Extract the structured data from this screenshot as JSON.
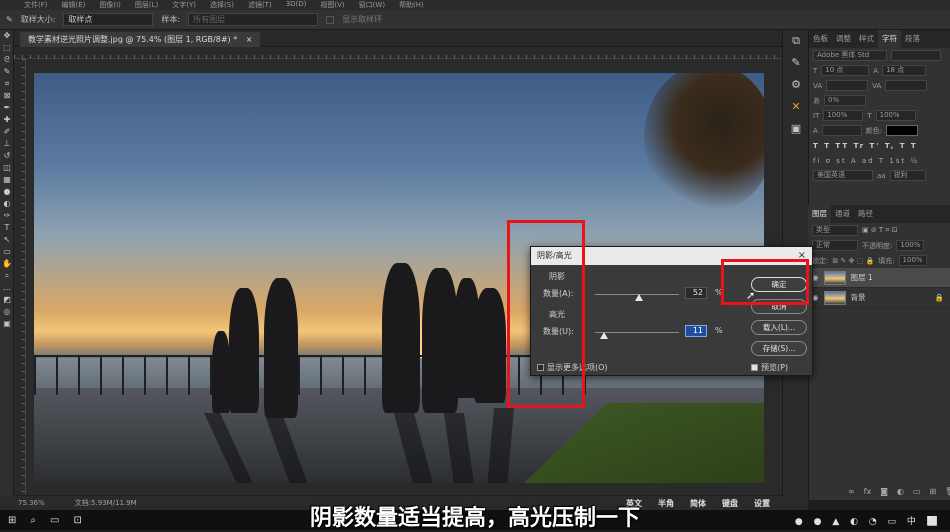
{
  "menubar": [
    "文件(F)",
    "编辑(E)",
    "图像(I)",
    "图层(L)",
    "文字(Y)",
    "选择(S)",
    "滤镜(T)",
    "3D(D)",
    "视图(V)",
    "窗口(W)",
    "帮助(H)"
  ],
  "optbar": {
    "sample_size_label": "取样大小:",
    "sample_size_value": "取样点",
    "sample_label": "样本:",
    "sample_value": "所有图层",
    "show_ring_label": "显示取样环"
  },
  "document": {
    "tab_title": "教学素材逆光照片调整.jpg @ 75.4% (图层 1, RGB/8#) *",
    "zoom": "75.36%",
    "doc_size": "文档:5.93M/11.9M"
  },
  "panels": {
    "tabs": [
      "色板",
      "调整",
      "样式",
      "字符",
      "段落"
    ],
    "active_tab": "字符",
    "font_family": "Adobe 黑体 Std",
    "font_size": "10 点",
    "leading": "18 点",
    "tracking": "0%",
    "scale_v": "100%",
    "scale_h": "100%",
    "color_label": "颜色:",
    "language": "美国英语",
    "antialias": "锐利"
  },
  "layers": {
    "tabs": [
      "图层",
      "通道",
      "路径"
    ],
    "kind_label": "类型",
    "blend_mode": "正常",
    "opacity_label": "不透明度:",
    "opacity_value": "100%",
    "lock_label": "锁定:",
    "fill_label": "填充:",
    "fill_value": "100%",
    "items": [
      {
        "name": "图层 1",
        "selected": true
      },
      {
        "name": "背景",
        "selected": false
      }
    ]
  },
  "dialog": {
    "title": "阴影/高光",
    "shadows_section": "阴影",
    "highlights_section": "高光",
    "amount_label_a": "数量(A):",
    "amount_value_a": "52",
    "amount_label_u": "数量(U):",
    "amount_value_u": "11",
    "percent": "%",
    "shadow_amount": 0.52,
    "highlight_amount": 0.11,
    "ok": "确定",
    "cancel": "取消",
    "load": "载入(L)...",
    "save": "存储(S)...",
    "preview": "预览(P)",
    "preview_checked": true,
    "more_options": "显示更多选项(O)",
    "more_options_checked": false
  },
  "ime": [
    "英文",
    "半角",
    "简体",
    "键盘",
    "设置"
  ],
  "subtitle": "阴影数量适当提高，高光压制一下",
  "colors": {
    "highlight_box": "#e8141a",
    "active_input": "#1f4f9c"
  }
}
